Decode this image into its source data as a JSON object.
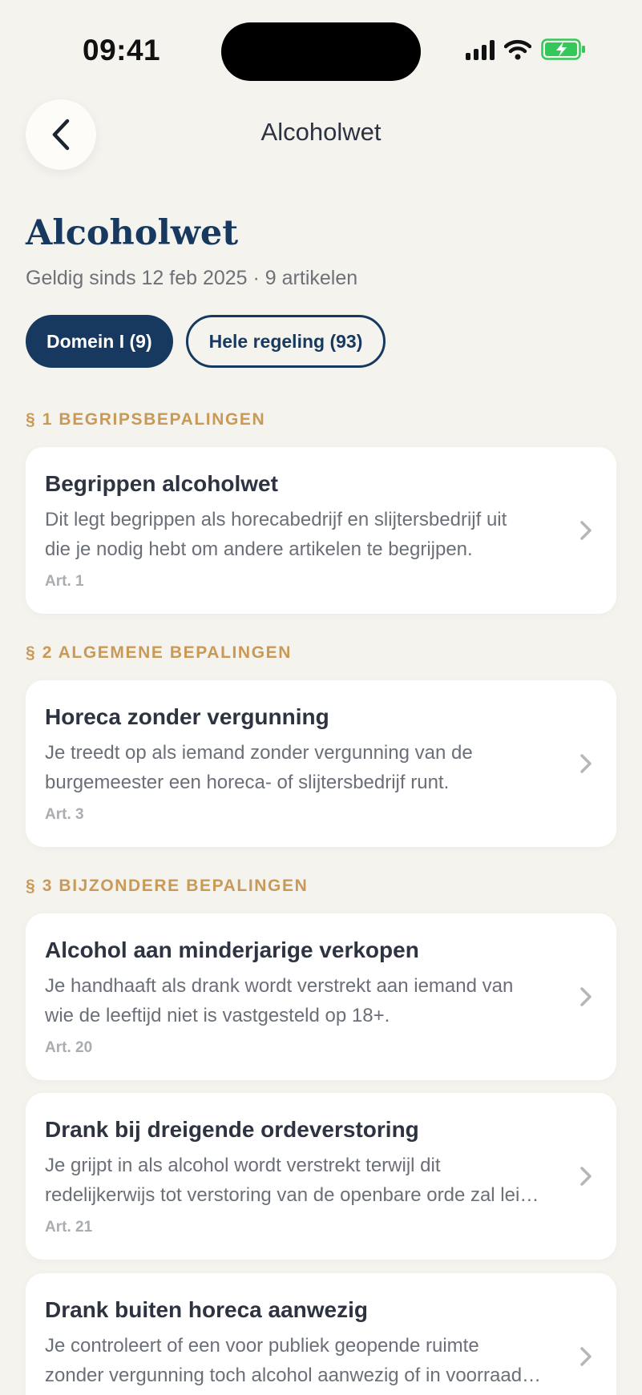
{
  "status_bar": {
    "time": "09:41"
  },
  "nav": {
    "title": "Alcoholwet"
  },
  "page": {
    "title": "Alcoholwet",
    "subtitle": "Geldig sinds 12 feb 2025 · 9 artikelen"
  },
  "filters": [
    {
      "label": "Domein I (9)",
      "active": true
    },
    {
      "label": "Hele regeling (93)",
      "active": false
    }
  ],
  "sections": [
    {
      "header": "§ 1 BEGRIPSBEPALINGEN"
    },
    {
      "header": "§ 2 ALGEMENE BEPALINGEN"
    },
    {
      "header": "§ 3 BIJZONDERE BEPALINGEN"
    }
  ],
  "articles": [
    {
      "title": "Begrippen alcoholwet",
      "desc_line1": "Dit legt begrippen als horecabedrijf en slijtersbedrijf uit",
      "desc_line2": "die je nodig hebt om andere artikelen te begrijpen.",
      "art": "Art. 1"
    },
    {
      "title": "Horeca zonder vergunning",
      "desc_line1": "Je treedt op als iemand zonder vergunning van de",
      "desc_line2": "burgemeester een horeca- of slijtersbedrijf runt.",
      "art": "Art. 3"
    },
    {
      "title": "Alcohol aan minderjarige verkopen",
      "desc_line1": "Je handhaaft als drank wordt verstrekt aan iemand van",
      "desc_line2": "wie de leeftijd niet is vastgesteld op 18+.",
      "art": "Art. 20"
    },
    {
      "title": "Drank bij dreigende ordeverstoring",
      "desc_line1": "Je grijpt in als alcohol wordt verstrekt terwijl dit",
      "desc_line2": "redelijkerwijs tot verstoring van de openbare orde zal lei…",
      "art": "Art. 21"
    },
    {
      "title": "Drank buiten horeca aanwezig",
      "desc_line1": "Je controleert of een voor publiek geopende ruimte",
      "desc_line2": "zonder vergunning toch alcohol aanwezig of in voorraad…",
      "art": ""
    }
  ],
  "icons": {
    "back": "chevron-left-icon",
    "card_arrow": "chevron-right-icon"
  },
  "colors": {
    "background": "#f5f3ee",
    "primary": "#17395f",
    "section_accent": "#c99957",
    "battery": "#34c759"
  }
}
